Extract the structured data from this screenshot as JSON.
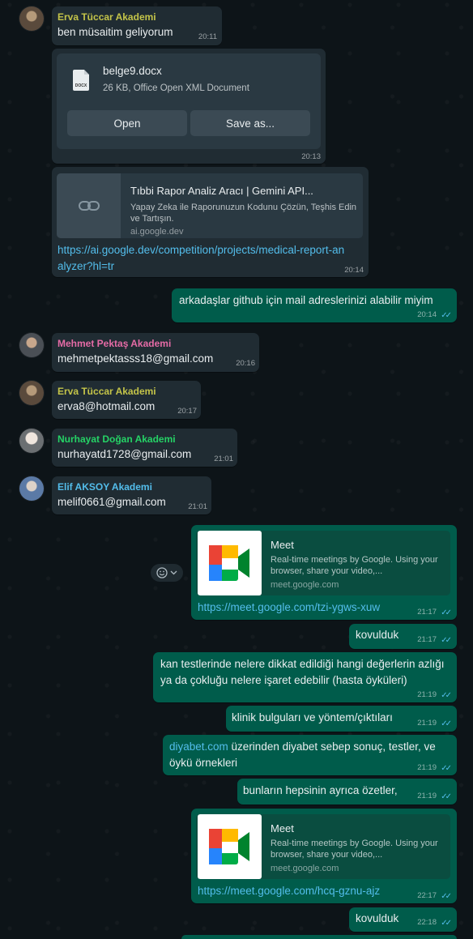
{
  "messages": {
    "m1": {
      "sender": "Erva Tüccar Akademi",
      "text": "ben müsaitim geliyorum",
      "time": "20:11"
    },
    "m2": {
      "file_name": "belge9.docx",
      "file_info": "26 KB, Office Open XML Document",
      "ext": "DOCX",
      "open_label": "Open",
      "save_label": "Save as...",
      "time": "20:13"
    },
    "m3": {
      "preview_title": "Tıbbi Rapor Analiz Aracı  |  Gemini API...",
      "preview_desc": "Yapay Zeka ile Raporunuzun Kodunu Çözün, Teşhis Edin ve Tartışın.",
      "preview_domain": "ai.google.dev",
      "url": "https://ai.google.dev/competition/projects/medical-report-analyzer?hl=tr",
      "time": "20:14"
    },
    "m4": {
      "text": "arkadaşlar github için mail adreslerinizi alabilir miyim",
      "time": "20:14"
    },
    "m5": {
      "sender": "Mehmet Pektaş Akademi",
      "text": "mehmetpektasss18@gmail.com",
      "time": "20:16"
    },
    "m6": {
      "sender": "Erva Tüccar Akademi",
      "text": "erva8@hotmail.com",
      "time": "20:17"
    },
    "m7": {
      "sender": "Nurhayat Doğan Akademi",
      "text": "nurhayatd1728@gmail.com",
      "time": "21:01"
    },
    "m8": {
      "sender": "Elif AKSOY Akademi",
      "text": "melif0661@gmail.com",
      "time": "21:01"
    },
    "m9": {
      "preview_title": "Meet",
      "preview_desc": "Real-time meetings by Google. Using your browser, share your video,...",
      "preview_domain": "meet.google.com",
      "url": "https://meet.google.com/tzi-ygws-xuw",
      "time": "21:17"
    },
    "m10": {
      "text": "kovulduk",
      "time": "21:17"
    },
    "m11": {
      "text": "kan testlerinde nelere dikkat edildiği hangi değerlerin azlığı ya da çokluğu nelere işaret edebilir (hasta öyküleri)",
      "time": "21:19"
    },
    "m12": {
      "text": "klinik bulguları ve yöntem/çıktıları",
      "time": "21:19"
    },
    "m13": {
      "link": "diyabet.com",
      "text": " üzerinden diyabet sebep sonuç, testler, ve öykü örnekleri",
      "time": "21:19"
    },
    "m14": {
      "text": "bunların hepsinin ayrıca özetler,",
      "time": "21:19"
    },
    "m15": {
      "preview_title": "Meet",
      "preview_desc": "Real-time meetings by Google. Using your browser, share your video,...",
      "preview_domain": "meet.google.com",
      "url": "https://meet.google.com/hcq-gznu-ajz",
      "time": "22:17"
    },
    "m16": {
      "text": "kovulduk",
      "time": "22:18"
    }
  },
  "colors": {
    "background": "#0d1418",
    "incoming_bubble": "#202c33",
    "outgoing_bubble": "#005c4b",
    "link": "#53bdeb",
    "read_ticks": "#53bdeb",
    "sender_erva": "#c4c449",
    "sender_mehmet": "#e56ba6",
    "sender_nurhayat": "#25d366",
    "sender_elif": "#53bdeb"
  },
  "icons": {
    "read_receipt": "double-check-icon",
    "link_preview": "link-icon",
    "document": "docx-file-icon",
    "meet_logo": "google-meet-logo",
    "reaction": "smiley-icon"
  }
}
